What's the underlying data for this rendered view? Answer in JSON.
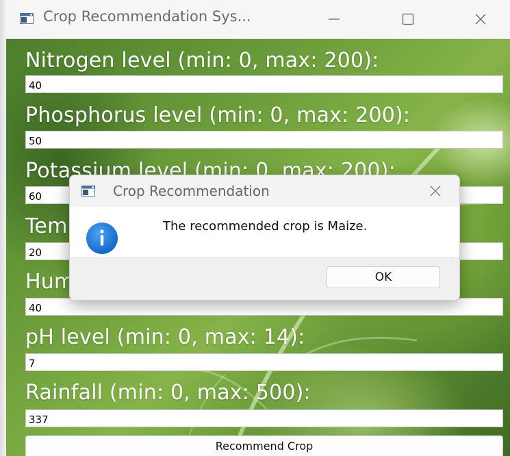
{
  "window": {
    "title": "Crop Recommendation Sys...",
    "icon": "app-window-icon",
    "controls": [
      "minimize-icon",
      "maximize-icon",
      "close-icon"
    ]
  },
  "form": {
    "fields": [
      {
        "label": "Nitrogen level (min: 0, max: 200):",
        "value": "40"
      },
      {
        "label": "Phosphorus level (min: 0, max: 200):",
        "value": "50"
      },
      {
        "label": "Potassium level (min: 0, max: 200):",
        "value": "60"
      },
      {
        "label": "Tem",
        "value": "20"
      },
      {
        "label": "Hum",
        "value": "40"
      },
      {
        "label": "pH level (min: 0, max: 14):",
        "value": "7"
      },
      {
        "label": "Rainfall (min: 0, max: 500):",
        "value": "337"
      }
    ],
    "submit_label": "Recommend Crop"
  },
  "dialog": {
    "title": "Crop Recommendation",
    "message": "The recommended crop is Maize.",
    "ok_label": "OK",
    "icon": "info-icon"
  },
  "colors": {
    "background_green": "#6e9f3b",
    "label_text": "#ffffff",
    "info_blue": "#1a73d9"
  }
}
